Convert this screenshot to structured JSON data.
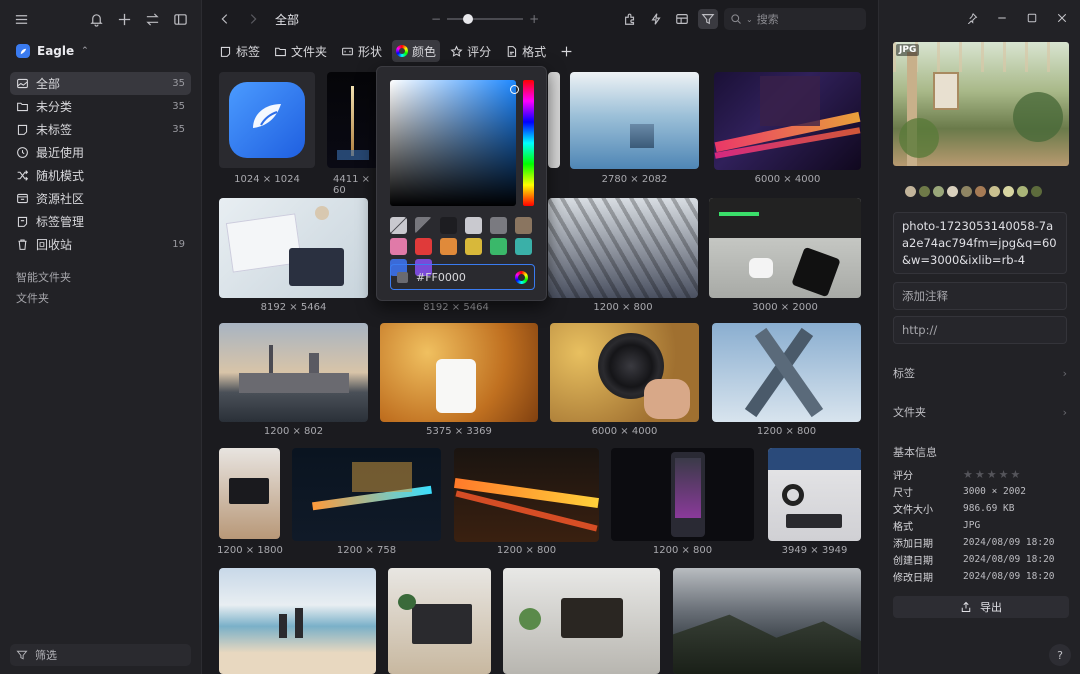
{
  "sidebar": {
    "library_name": "Eagle",
    "nav": [
      {
        "label": "全部",
        "count": "35"
      },
      {
        "label": "未分类",
        "count": "35"
      },
      {
        "label": "未标签",
        "count": "35"
      },
      {
        "label": "最近使用",
        "count": ""
      },
      {
        "label": "随机模式",
        "count": ""
      },
      {
        "label": "资源社区",
        "count": ""
      },
      {
        "label": "标签管理",
        "count": ""
      },
      {
        "label": "回收站",
        "count": "19"
      }
    ],
    "smart_folders": "智能文件夹",
    "folders": "文件夹",
    "filter_label": "筛选"
  },
  "topbar": {
    "breadcrumb": "全部",
    "search_placeholder": "搜索"
  },
  "filters": [
    "标签",
    "文件夹",
    "形状",
    "颜色",
    "评分",
    "格式"
  ],
  "color_picker": {
    "hex": "#FF0000",
    "swatches": [
      "#c9c9cf",
      "#77777d",
      "#1d1d21",
      "#c9c9cf",
      "#7a7a80",
      "#8a7560",
      "#e07aa8",
      "#e03a3a",
      "#e08a3a",
      "#d8b83a",
      "#3ab86a",
      "#3ab0a8",
      "#3a6ad8",
      "#7a4ad8"
    ]
  },
  "grid": {
    "captions": [
      "1024 × 1024",
      "4411 × 60",
      "2780 × 2082",
      "6000 × 4000",
      "8192 × 5464",
      "8192 × 5464",
      "1200 × 800",
      "3000 × 2000",
      "1200 × 802",
      "5375 × 3369",
      "6000 × 4000",
      "1200 × 800",
      "1200 × 1800",
      "1200 × 758",
      "1200 × 800",
      "1200 × 800",
      "3949 × 3949"
    ]
  },
  "inspector": {
    "badge": "JPG",
    "palette": [
      "#c2b49a",
      "#6f7a48",
      "#9aa77a",
      "#d9d0bd",
      "#8f8563",
      "#a67b55",
      "#c9c08f",
      "#d8d6a2",
      "#aab578",
      "#5d6b3c"
    ],
    "filename": "photo-1723053140058-7aa2e74ac794fm=jpg&q=60&w=3000&ixlib=rb-4",
    "note_placeholder": "添加注释",
    "url_placeholder": "http://",
    "tags_label": "标签",
    "folder_label": "文件夹",
    "info_title": "基本信息",
    "info": [
      {
        "k": "评分",
        "v": ""
      },
      {
        "k": "尺寸",
        "v": "3000 × 2002"
      },
      {
        "k": "文件大小",
        "v": "986.69 KB"
      },
      {
        "k": "格式",
        "v": "JPG"
      },
      {
        "k": "添加日期",
        "v": "2024/08/09 18:20"
      },
      {
        "k": "创建日期",
        "v": "2024/08/09 18:20"
      },
      {
        "k": "修改日期",
        "v": "2024/08/09 18:20"
      }
    ],
    "export_label": "导出",
    "help": "?"
  }
}
